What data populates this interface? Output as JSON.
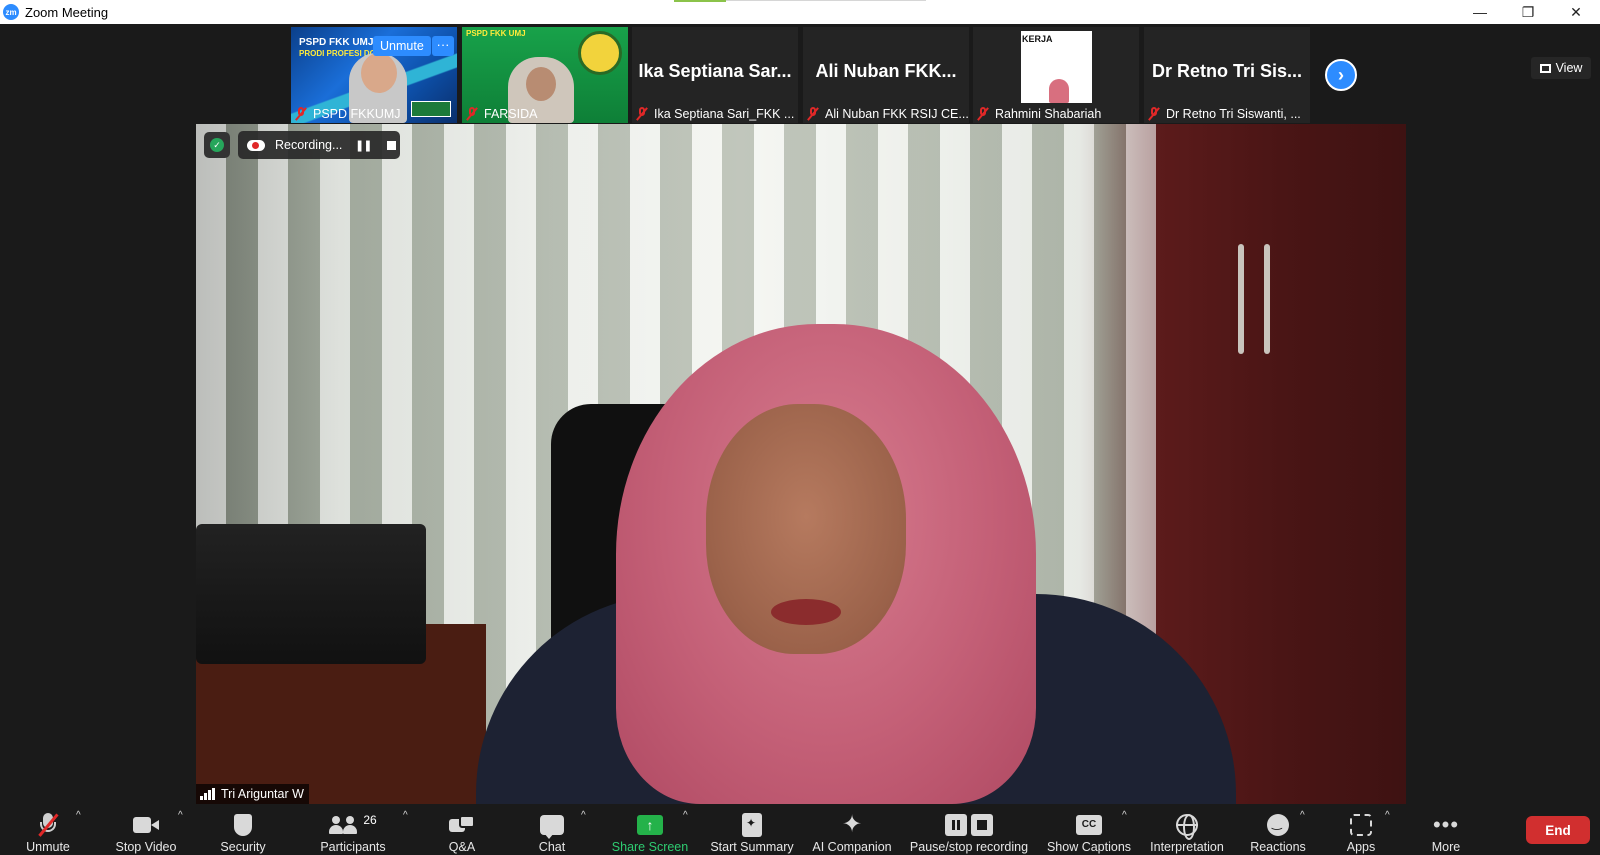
{
  "window": {
    "title": "Zoom Meeting",
    "logo_text": "zm",
    "controls": {
      "minimize": "—",
      "restore": "❐",
      "close": "✕"
    }
  },
  "gallery": {
    "hover_unmute": "Unmute",
    "hover_more": "···",
    "tiles": [
      {
        "name": "PSPD FKKUMJ",
        "muted": true,
        "slide_header": "PSPD FKK UMJ",
        "slide_subheader": "PRODI PROFESI DOKTER"
      },
      {
        "name": "FARSIDA",
        "muted": true,
        "slide_header": "PSPD FKK UMJ"
      },
      {
        "big_name": "Ika Septiana Sar...",
        "name": "Ika Septiana Sari_FKK ...",
        "muted": true
      },
      {
        "big_name": "Ali Nuban FKK...",
        "name": "Ali Nuban FKK RSIJ CE...",
        "muted": true
      },
      {
        "name": "Rahmini Shabariah",
        "muted": true,
        "slide_title": "KERJA"
      },
      {
        "big_name": "Dr Retno Tri Sis...",
        "name": "Dr Retno Tri Siswanti, ...",
        "muted": true
      }
    ],
    "next_arrow": "›"
  },
  "view_button": {
    "label": "View"
  },
  "main_video": {
    "speaker_name": "Tri Ariguntar W",
    "recording": {
      "label": "Recording...",
      "pause_glyph": "❚❚"
    },
    "security_glyph": "✓"
  },
  "toolbar": {
    "unmute": "Unmute",
    "stop_video": "Stop Video",
    "security": "Security",
    "participants": "Participants",
    "participants_count": "26",
    "qa": "Q&A",
    "chat": "Chat",
    "share_screen": "Share Screen",
    "share_glyph": "↑",
    "start_summary": "Start Summary",
    "ai_companion": "AI Companion",
    "ai_glyph": "✦",
    "pause_stop_recording": "Pause/stop recording",
    "show_captions": "Show Captions",
    "cc_glyph": "CC",
    "interpretation": "Interpretation",
    "reactions": "Reactions",
    "apps": "Apps",
    "more": "More",
    "more_glyph": "•••",
    "caret": "^",
    "end": "End"
  },
  "colors": {
    "accent": "#2D8CFF",
    "end_button": "#D12F2F",
    "share_green": "#24B24A",
    "muted_red": "#E02828"
  }
}
